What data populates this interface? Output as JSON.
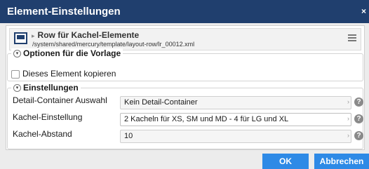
{
  "dialog": {
    "title": "Element-Einstellungen",
    "close_label": "×"
  },
  "element": {
    "arrow": "▸",
    "title": "Row für Kachel-Elemente",
    "path": "/system/shared/mercury/template/layout-row/lr_00012.xml"
  },
  "template_options": {
    "legend": "Optionen für die Vorlage",
    "toggle": "▾",
    "copy_label": "Dieses Element kopieren"
  },
  "settings": {
    "legend": "Einstellungen",
    "toggle": "▾",
    "fields": [
      {
        "label": "Detail-Container Auswahl",
        "value": "Kein Detail-Container"
      },
      {
        "label": "Kachel-Einstellung",
        "value": "2 Kacheln für XS, SM und MD - 4 für LG und XL"
      },
      {
        "label": "Kachel-Abstand",
        "value": "10"
      }
    ],
    "chevron": "›",
    "help": "?"
  },
  "buttons": {
    "ok": "OK",
    "cancel": "Abbrechen"
  },
  "colors": {
    "titlebar": "#203f6e",
    "button": "#2e8ae6"
  }
}
